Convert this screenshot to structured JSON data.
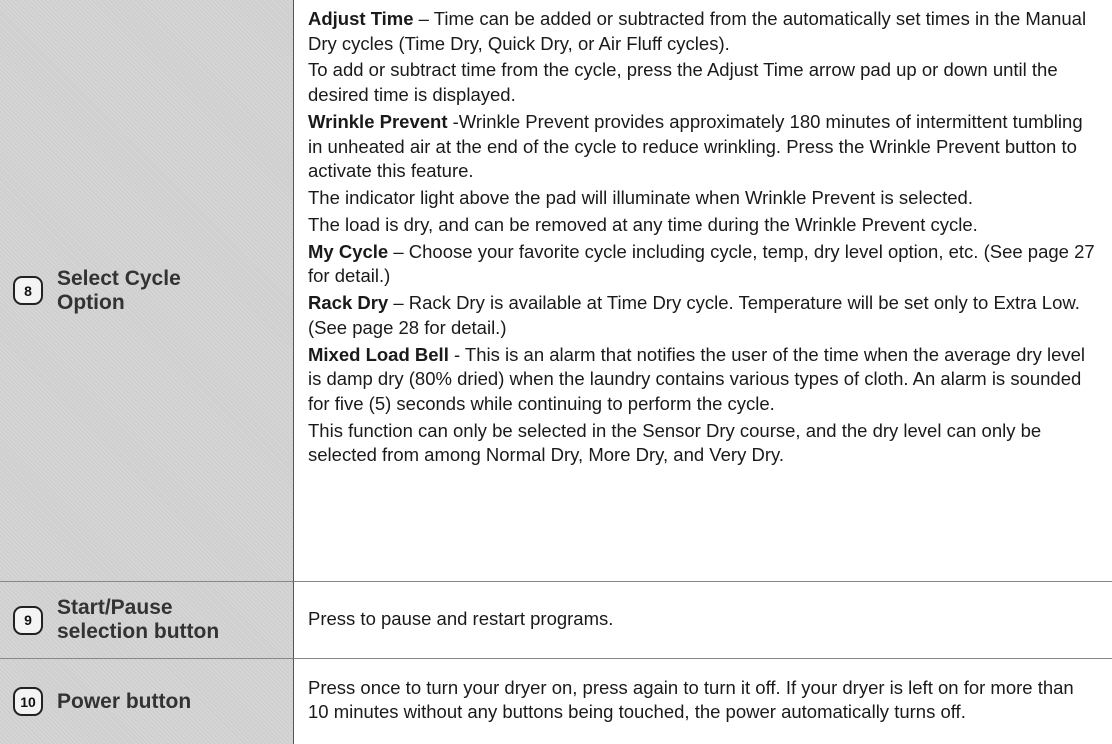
{
  "rows": [
    {
      "number": "8",
      "label_lines": [
        "Select Cycle",
        "Option"
      ],
      "paragraphs": [
        {
          "term": "Adjust Time",
          "text": " – Time can be added or subtracted from the automatically set times in the Manual Dry cycles (Time Dry, Quick Dry, or Air Fluff cycles)."
        },
        {
          "term": "",
          "text": "To add or subtract time from the cycle, press the Adjust Time arrow pad up or down until the desired time is displayed."
        },
        {
          "term": "Wrinkle Prevent",
          "text": " -Wrinkle Prevent provides approximately 180 minutes of intermittent tumbling in unheated air at the end of the cycle to reduce wrinkling. Press the Wrinkle Prevent button to activate this feature."
        },
        {
          "term": "",
          "text": "The indicator light above the pad will illuminate when Wrinkle Prevent is selected."
        },
        {
          "term": "",
          "text": "The load is dry, and can be removed at any time during the Wrinkle Prevent cycle."
        },
        {
          "term": "My Cycle",
          "text": " – Choose your favorite cycle including cycle, temp, dry level option, etc. (See page 27 for detail.)"
        },
        {
          "term": "Rack Dry",
          "text": " – Rack Dry is available at Time Dry cycle. Temperature will be set only to Extra Low. (See page 28 for detail.)"
        },
        {
          "term": "Mixed Load Bell",
          "text": " - This is an alarm that notifies the user of the time when the average dry level is damp dry (80% dried) when the laundry contains various types of cloth. An alarm is sounded for five (5) seconds while continuing to perform the cycle."
        },
        {
          "term": "",
          "text": "This function can only be selected in the Sensor Dry course, and the dry level can only be selected from among Normal Dry, More Dry, and Very Dry."
        }
      ]
    },
    {
      "number": "9",
      "label_lines": [
        "Start/Pause",
        "selection button"
      ],
      "paragraphs": [
        {
          "term": "",
          "text": "Press to pause and restart programs."
        }
      ]
    },
    {
      "number": "10",
      "label_lines": [
        "Power button"
      ],
      "paragraphs": [
        {
          "term": "",
          "text": "Press once to turn your dryer on, press again to turn it off. If your dryer is left on for more than 10 minutes without any buttons being touched, the power automatically turns off."
        }
      ]
    }
  ]
}
